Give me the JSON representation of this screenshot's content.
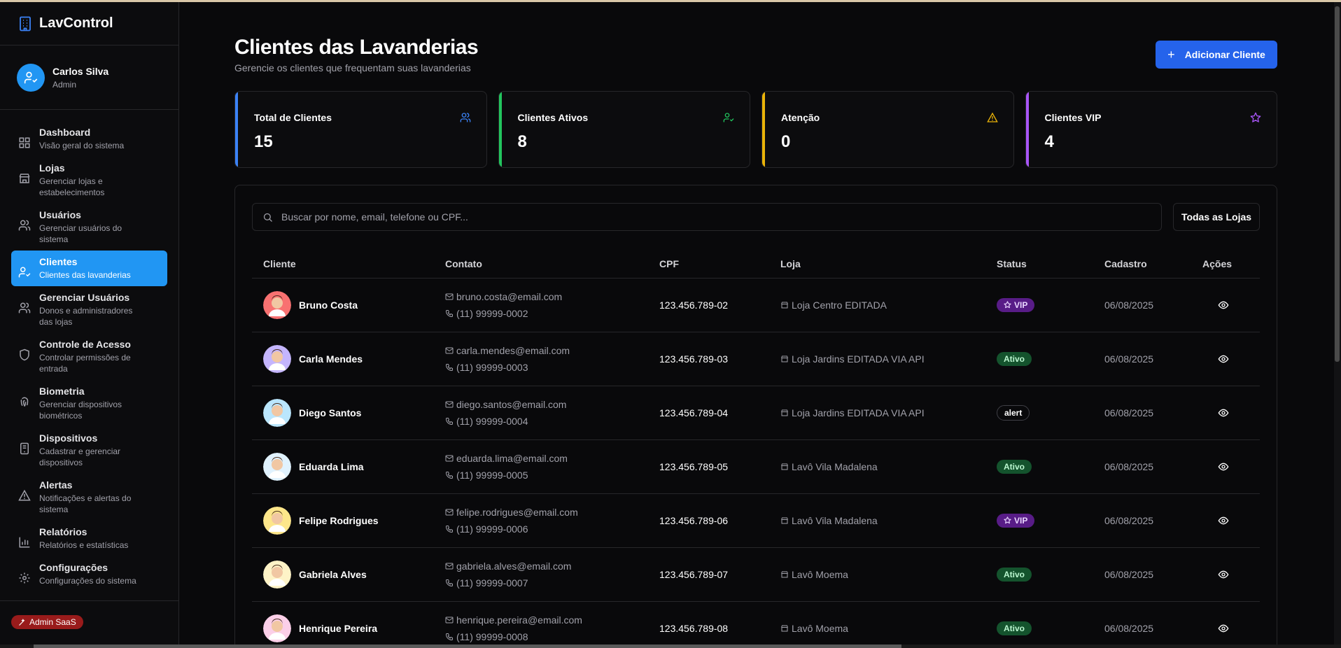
{
  "app": {
    "name": "LavControl"
  },
  "user": {
    "name": "Carlos Silva",
    "role": "Admin"
  },
  "nav": [
    {
      "label": "Dashboard",
      "sub": "Visão geral do sistema",
      "icon": "dashboard-icon",
      "active": false
    },
    {
      "label": "Lojas",
      "sub": "Gerenciar lojas e estabelecimentos",
      "icon": "store-icon",
      "active": false
    },
    {
      "label": "Usuários",
      "sub": "Gerenciar usuários do sistema",
      "icon": "users-icon",
      "active": false
    },
    {
      "label": "Clientes",
      "sub": "Clientes das lavanderias",
      "icon": "user-check-icon",
      "active": true
    },
    {
      "label": "Gerenciar Usuários",
      "sub": "Donos e administradores das lojas",
      "icon": "users-cog-icon",
      "active": false
    },
    {
      "label": "Controle de Acesso",
      "sub": "Controlar permissões de entrada",
      "icon": "shield-icon",
      "active": false
    },
    {
      "label": "Biometria",
      "sub": "Gerenciar dispositivos biométricos",
      "icon": "fingerprint-icon",
      "active": false
    },
    {
      "label": "Dispositivos",
      "sub": "Cadastrar e gerenciar dispositivos",
      "icon": "device-icon",
      "active": false
    },
    {
      "label": "Alertas",
      "sub": "Notificações e alertas do sistema",
      "icon": "alert-icon",
      "active": false
    },
    {
      "label": "Relatórios",
      "sub": "Relatórios e estatísticas",
      "icon": "chart-icon",
      "active": false
    },
    {
      "label": "Configurações",
      "sub": "Configurações do sistema",
      "icon": "gear-icon",
      "active": false
    }
  ],
  "footer": {
    "badge": "Admin SaaS"
  },
  "page": {
    "title": "Clientes das Lavanderias",
    "subtitle": "Gerencie os clientes que frequentam suas lavanderias",
    "add_button": "Adicionar Cliente"
  },
  "stats": [
    {
      "label": "Total de Clientes",
      "value": "15",
      "color": "#3b82f6",
      "icon": "users-icon"
    },
    {
      "label": "Clientes Ativos",
      "value": "8",
      "color": "#22c55e",
      "icon": "user-check-icon"
    },
    {
      "label": "Atenção",
      "value": "0",
      "color": "#eab308",
      "icon": "warning-icon"
    },
    {
      "label": "Clientes VIP",
      "value": "4",
      "color": "#a855f7",
      "icon": "star-icon"
    }
  ],
  "search": {
    "placeholder": "Buscar por nome, email, telefone ou CPF..."
  },
  "filter": {
    "label": "Todas as Lojas"
  },
  "table": {
    "headers": [
      "Cliente",
      "Contato",
      "CPF",
      "Loja",
      "Status",
      "Cadastro",
      "Ações"
    ],
    "rows": [
      {
        "name": "Bruno Costa",
        "email": "bruno.costa@email.com",
        "phone": "(11) 99999-0002",
        "cpf": "123.456.789-02",
        "loja": "Loja Centro EDITADA",
        "status": "VIP",
        "date": "06/08/2025",
        "avatar_bg": "#f87171"
      },
      {
        "name": "Carla Mendes",
        "email": "carla.mendes@email.com",
        "phone": "(11) 99999-0003",
        "cpf": "123.456.789-03",
        "loja": "Loja Jardins EDITADA VIA API",
        "status": "Ativo",
        "date": "06/08/2025",
        "avatar_bg": "#c4b5fd"
      },
      {
        "name": "Diego Santos",
        "email": "diego.santos@email.com",
        "phone": "(11) 99999-0004",
        "cpf": "123.456.789-04",
        "loja": "Loja Jardins EDITADA VIA API",
        "status": "alert",
        "date": "06/08/2025",
        "avatar_bg": "#bae6fd"
      },
      {
        "name": "Eduarda Lima",
        "email": "eduarda.lima@email.com",
        "phone": "(11) 99999-0005",
        "cpf": "123.456.789-05",
        "loja": "Lavô Vila Madalena",
        "status": "Ativo",
        "date": "06/08/2025",
        "avatar_bg": "#e0f2fe"
      },
      {
        "name": "Felipe Rodrigues",
        "email": "felipe.rodrigues@email.com",
        "phone": "(11) 99999-0006",
        "cpf": "123.456.789-06",
        "loja": "Lavô Vila Madalena",
        "status": "VIP",
        "date": "06/08/2025",
        "avatar_bg": "#fde68a"
      },
      {
        "name": "Gabriela Alves",
        "email": "gabriela.alves@email.com",
        "phone": "(11) 99999-0007",
        "cpf": "123.456.789-07",
        "loja": "Lavô Moema",
        "status": "Ativo",
        "date": "06/08/2025",
        "avatar_bg": "#fef3c7"
      },
      {
        "name": "Henrique Pereira",
        "email": "henrique.pereira@email.com",
        "phone": "(11) 99999-0008",
        "cpf": "123.456.789-08",
        "loja": "Lavô Moema",
        "status": "Ativo",
        "date": "06/08/2025",
        "avatar_bg": "#fbcfe8"
      }
    ]
  }
}
